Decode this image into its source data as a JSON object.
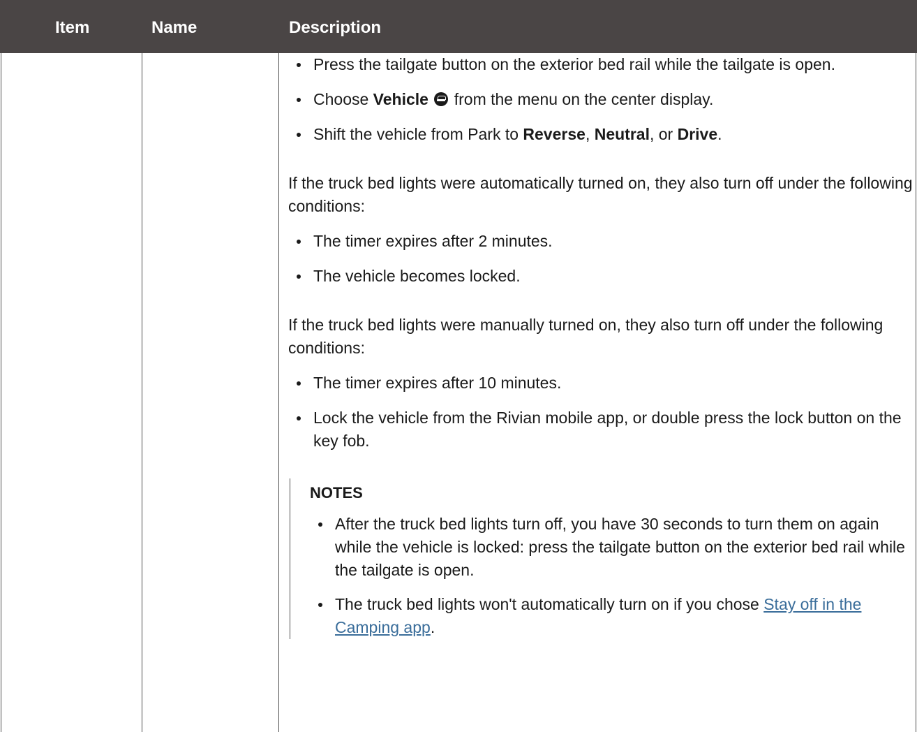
{
  "header": {
    "item": "Item",
    "name": "Name",
    "description": "Description"
  },
  "list1": {
    "b1": "Press the tailgate button on the exterior bed rail while the tailgate is open.",
    "b2_pre": "Choose ",
    "b2_bold": "Vehicle",
    "b2_icon": "vehicle-icon",
    "b2_post": " from the menu on the center display.",
    "b3_pre": "Shift the vehicle from Park to ",
    "b3_reverse": "Reverse",
    "b3_sep1": ", ",
    "b3_neutral": "Neutral",
    "b3_sep2": ", or ",
    "b3_drive": "Drive",
    "b3_end": "."
  },
  "para1": "If the truck bed lights were automatically turned on, they also turn off under the following conditions:",
  "list2": [
    "The timer expires after 2 minutes.",
    "The vehicle becomes locked."
  ],
  "para2": "If the truck bed lights were manually turned on, they also turn off under the following conditions:",
  "list3": [
    "The timer expires after 10 minutes.",
    "Lock the vehicle from the Rivian mobile app, or double press the lock button on the key fob."
  ],
  "notes": {
    "title": "NOTES",
    "n1": "After the truck bed lights turn off, you have 30 seconds to turn them on again while the vehicle is locked: press the tailgate button on the exterior bed rail while the tailgate is open.",
    "n2_pre": "The truck bed lights won't automatically turn on if you chose ",
    "n2_link": "Stay off in the Camping app",
    "n2_post": "."
  },
  "colors": {
    "header_bg": "#4a4545",
    "link": "#3a6d9a"
  }
}
